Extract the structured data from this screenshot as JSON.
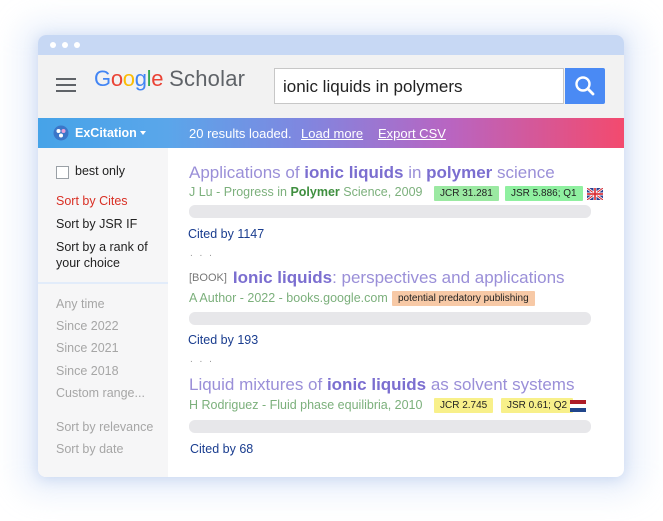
{
  "header": {
    "logo": {
      "letters": [
        "G",
        "o",
        "o",
        "g",
        "l",
        "e"
      ],
      "colors": [
        "#4285F4",
        "#EA4335",
        "#FBBC05",
        "#4285F4",
        "#34A853",
        "#EA4335"
      ],
      "word": "Scholar"
    },
    "search_value": "ionic liquids in polymers"
  },
  "excitation": {
    "brand": "ExCitation",
    "status": "20 results loaded.",
    "load_more": "Load more",
    "export": "Export CSV"
  },
  "sidebar": {
    "best_only": "best only",
    "sort_cites": "Sort by Cites",
    "sort_jsr": "Sort by JSR IF",
    "sort_rank": "Sort by a rank of your choice",
    "time_filters": [
      "Any time",
      "Since 2022",
      "Since 2021",
      "Since 2018",
      "Custom range..."
    ],
    "sort_relevance": "Sort by relevance",
    "sort_date": "Sort by date"
  },
  "results": [
    {
      "title_parts": [
        "Applications of ",
        "ionic liquids",
        " in ",
        "polymer",
        " science"
      ],
      "meta_parts": [
        "J Lu - Progress in ",
        "Polymer",
        " Science, 2009"
      ],
      "badges": [
        {
          "text": "JCR 31.281",
          "color": "#9be9a2"
        },
        {
          "text": "JSR 5.886; Q1",
          "color": "#8ff0a0"
        }
      ],
      "flag": "uk-flag-icon",
      "cited_by": "Cited by 1147"
    },
    {
      "book_tag": "[BOOK]",
      "title_parts": [
        "Ionic liquids",
        ": perspectives and applications"
      ],
      "meta": "A Author - 2022 - books.google.com",
      "badges": [
        {
          "text": "potential predatory publishing",
          "color": "#f7c9a6"
        }
      ],
      "cited_by": "Cited by 193"
    },
    {
      "title_parts": [
        "Liquid mixtures of ",
        "ionic liquids",
        " as solvent systems"
      ],
      "meta": "H Rodriguez - Fluid phase equilibria, 2010",
      "badges": [
        {
          "text": "JCR 2.745",
          "color": "#f8f08a"
        },
        {
          "text": "JSR 0.61; Q2",
          "color": "#f8f08a"
        }
      ],
      "flag": "netherlands-flag-icon",
      "cited_by": "Cited by 68"
    }
  ],
  "ellipsis": ". . ."
}
